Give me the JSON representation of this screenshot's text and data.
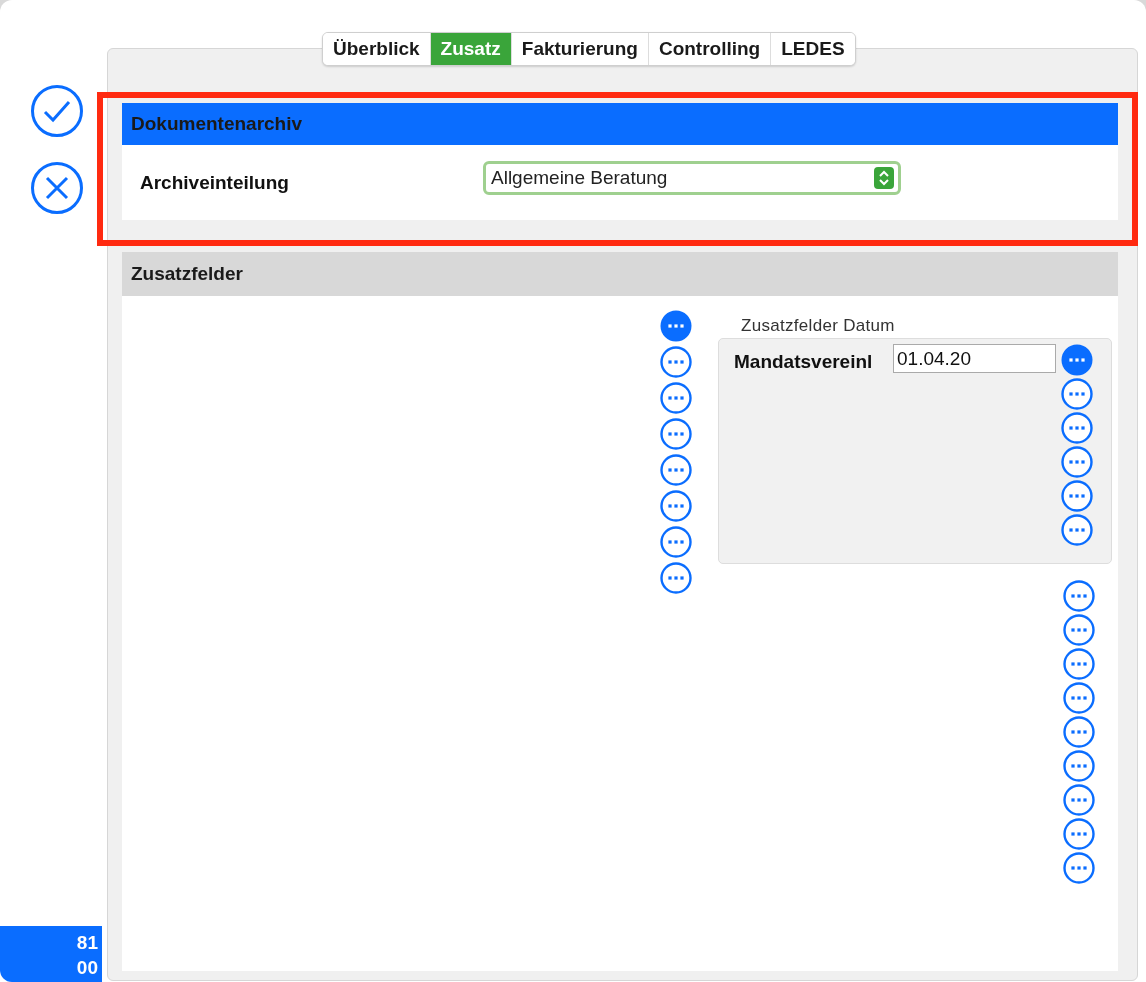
{
  "tabs": [
    {
      "label": "Überblick",
      "selected": false
    },
    {
      "label": "Zusatz",
      "selected": true
    },
    {
      "label": "Fakturierung",
      "selected": false
    },
    {
      "label": "Controlling",
      "selected": false
    },
    {
      "label": "LEDES",
      "selected": false
    }
  ],
  "archive_section": {
    "title": "Dokumentenarchiv",
    "highlighted": true,
    "field_label": "Archiveinteilung",
    "value": "Allgemeine Beratung"
  },
  "extra_section": {
    "title": "Zusatzfelder",
    "left_buttons": [
      {
        "active": true
      },
      {
        "active": false
      },
      {
        "active": false
      },
      {
        "active": false
      },
      {
        "active": false
      },
      {
        "active": false
      },
      {
        "active": false
      },
      {
        "active": false
      }
    ],
    "date_group": {
      "title": "Zusatzfelder Datum",
      "field_label": "Mandatsvereinl",
      "value": "01.04.20",
      "buttons": [
        {
          "active": true
        },
        {
          "active": false
        },
        {
          "active": false
        },
        {
          "active": false
        },
        {
          "active": false
        },
        {
          "active": false
        }
      ]
    },
    "lower_buttons": [
      {
        "active": false
      },
      {
        "active": false
      },
      {
        "active": false
      },
      {
        "active": false
      },
      {
        "active": false
      },
      {
        "active": false
      },
      {
        "active": false
      },
      {
        "active": false
      },
      {
        "active": false
      }
    ]
  },
  "badge": {
    "lines": [
      "81",
      "00"
    ]
  }
}
